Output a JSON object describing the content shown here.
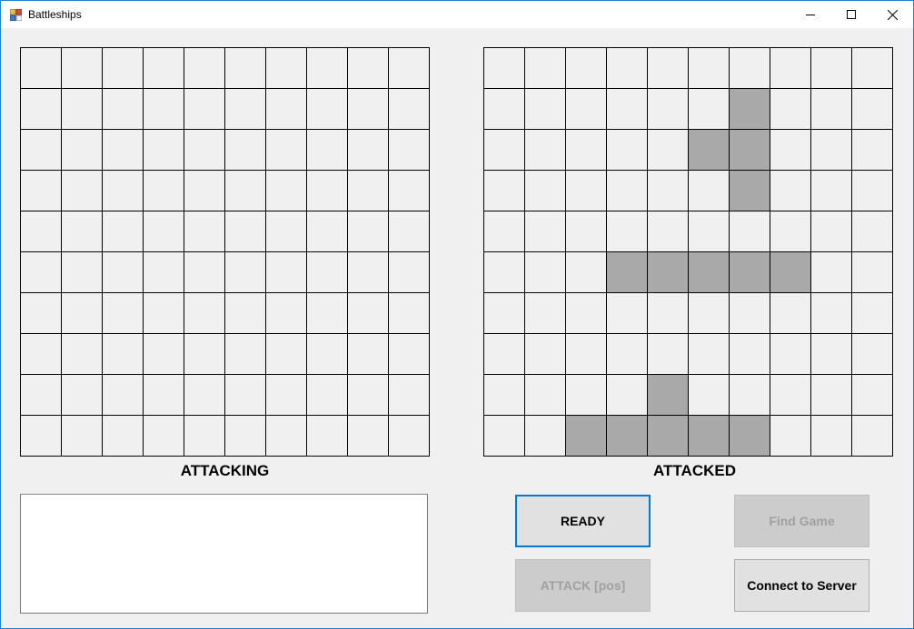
{
  "window": {
    "title": "Battleships",
    "accent_color": "#1883d7"
  },
  "attacking_grid": {
    "label": "ATTACKING",
    "rows": 10,
    "cols": 10,
    "ship_cells": []
  },
  "attacked_grid": {
    "label": "ATTACKED",
    "rows": 10,
    "cols": 10,
    "ship_color": "#a9a9a9",
    "ship_cells": [
      [
        1,
        6
      ],
      [
        2,
        5
      ],
      [
        2,
        6
      ],
      [
        3,
        6
      ],
      [
        5,
        3
      ],
      [
        5,
        4
      ],
      [
        5,
        5
      ],
      [
        5,
        6
      ],
      [
        5,
        7
      ],
      [
        8,
        4
      ],
      [
        9,
        2
      ],
      [
        9,
        3
      ],
      [
        9,
        4
      ],
      [
        9,
        5
      ],
      [
        9,
        6
      ]
    ]
  },
  "log": {
    "text": ""
  },
  "buttons": {
    "ready": "READY",
    "find_game": "Find Game",
    "attack": "ATTACK [pos]",
    "connect": "Connect to Server"
  }
}
